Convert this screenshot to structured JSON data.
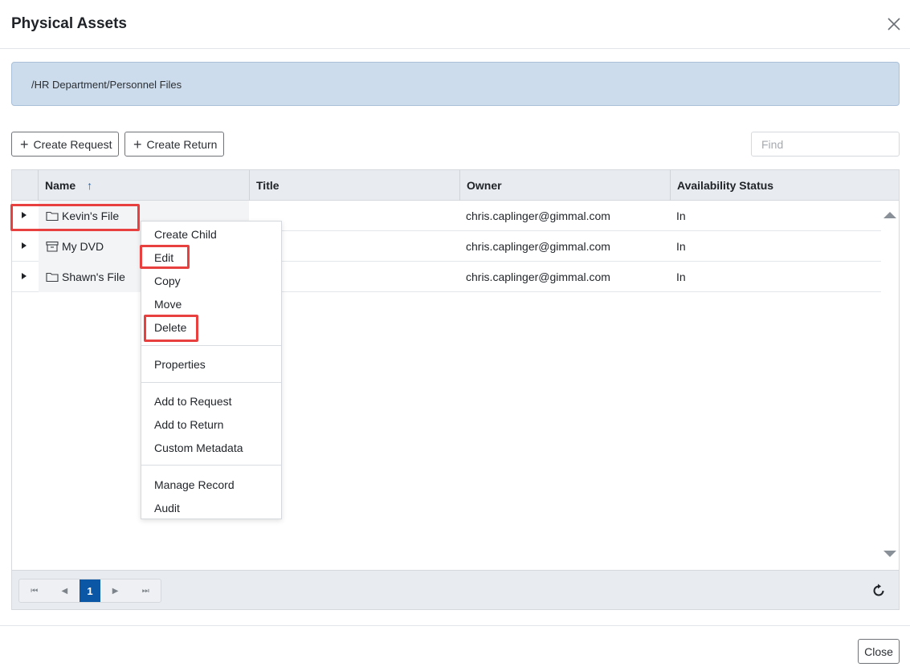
{
  "dialog": {
    "title": "Physical Assets",
    "close_label": "Close"
  },
  "breadcrumb": {
    "path": "/HR Department/Personnel Files"
  },
  "toolbar": {
    "create_request_label": "Create Request",
    "create_return_label": "Create Return",
    "find_placeholder": "Find"
  },
  "grid": {
    "columns": [
      "Name",
      "Title",
      "Owner",
      "Availability Status"
    ],
    "sort_indicator": "↑",
    "rows": [
      {
        "name": "Kevin's File",
        "icon": "folder-icon",
        "title": "",
        "owner": "chris.caplinger@gimmal.com",
        "status": "In"
      },
      {
        "name": "My DVD",
        "icon": "archive-box-icon",
        "title": "",
        "owner": "chris.caplinger@gimmal.com",
        "status": "In"
      },
      {
        "name": "Shawn's File",
        "icon": "folder-icon",
        "title": "",
        "owner": "chris.caplinger@gimmal.com",
        "status": "In"
      }
    ]
  },
  "pager": {
    "current_page": "1",
    "first": "⏮",
    "prev": "◀",
    "next": "▶",
    "last": "⏭"
  },
  "context_menu": {
    "items": [
      "Create Child",
      "Edit",
      "Copy",
      "Move",
      "Delete",
      "Properties",
      "Add to Request",
      "Add to Return",
      "Custom Metadata",
      "Manage Record",
      "Audit"
    ]
  },
  "colors": {
    "highlight": "#e8403f",
    "accent": "#0c56a6",
    "breadcrumb_bg": "#cddced"
  }
}
